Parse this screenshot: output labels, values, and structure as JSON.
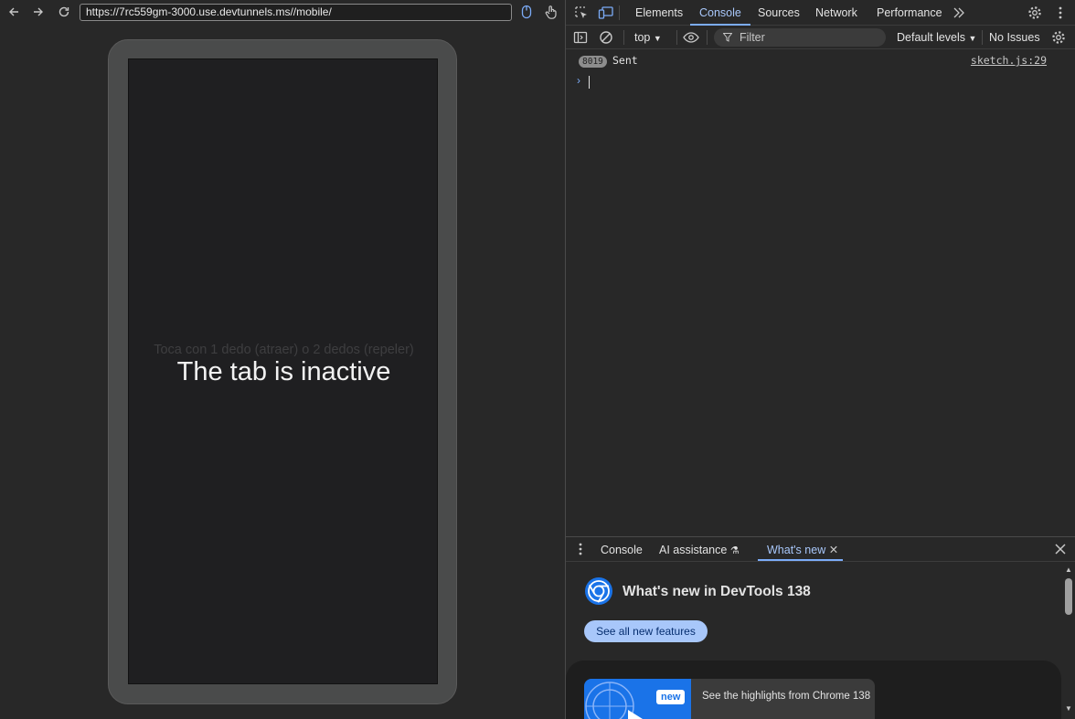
{
  "browser": {
    "url": "https://7rc559gm-3000.use.devtunnels.ms//mobile/"
  },
  "page": {
    "hint_text": "Toca con 1 dedo (atraer) o 2 dedos (repeler)",
    "overlay_text": "The tab is inactive"
  },
  "devtools": {
    "tabs": [
      {
        "label": "Elements"
      },
      {
        "label": "Console"
      },
      {
        "label": "Sources"
      },
      {
        "label": "Network"
      },
      {
        "label": "Performance"
      }
    ],
    "toolbar": {
      "context": "top",
      "filter_placeholder": "Filter",
      "levels": "Default levels",
      "issues": "No Issues"
    },
    "console": {
      "log": {
        "count": "8019",
        "message": "Sent",
        "source": "sketch.js:29"
      }
    },
    "drawer": {
      "tabs": [
        {
          "label": "Console"
        },
        {
          "label": "AI assistance"
        },
        {
          "label": "What's new"
        }
      ],
      "whats_new": {
        "title": "What's new in DevTools 138",
        "button": "See all new features",
        "badge": "new",
        "card_text": "See the highlights from Chrome 138"
      }
    }
  },
  "colors": {
    "accent": "#a8c7fa",
    "background": "#282828"
  }
}
